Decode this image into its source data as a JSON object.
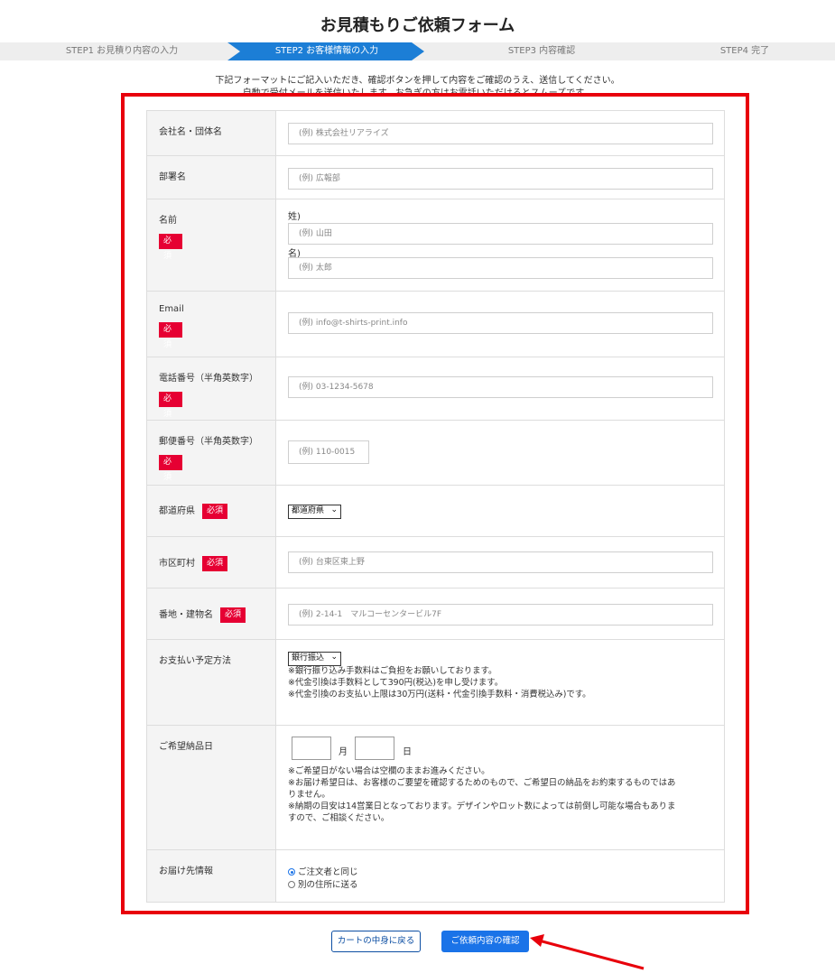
{
  "page": {
    "title": "お見積もりご依頼フォーム",
    "intro_line1": "下記フォーマットにご記入いただき、確認ボタンを押して内容をご確認のうえ、送信してください。",
    "intro_line2": "自動で受付メールを送信いたします。お急ぎの方はお電話いただけるとスムーズです。"
  },
  "steps": [
    {
      "label": "STEP1 お見積り内容の入力",
      "active": false
    },
    {
      "label": "STEP2 お客様情報の入力",
      "active": true
    },
    {
      "label": "STEP3 内容確認",
      "active": false
    },
    {
      "label": "STEP4 完了",
      "active": false
    }
  ],
  "required_label": "必須",
  "fields": {
    "company": {
      "label": "会社名・団体名",
      "placeholder": "(例) 株式会社リアライズ"
    },
    "department": {
      "label": "部署名",
      "placeholder": "(例) 広報部"
    },
    "name": {
      "label": "名前",
      "last_label": "姓)",
      "last_placeholder": "(例) 山田",
      "first_label": "名)",
      "first_placeholder": "(例) 太郎"
    },
    "email": {
      "label": "Email",
      "placeholder": "(例) info@t-shirts-print.info"
    },
    "phone": {
      "label": "電話番号（半角英数字）",
      "placeholder": "(例) 03-1234-5678"
    },
    "zip": {
      "label": "郵便番号（半角英数字）",
      "placeholder": "(例) 110-0015"
    },
    "prefecture": {
      "label": "都道府県",
      "selected": "都道府県"
    },
    "city": {
      "label": "市区町村",
      "placeholder": "(例) 台東区東上野"
    },
    "address": {
      "label": "番地・建物名",
      "placeholder": "(例) 2-14-1　マルコーセンタービル7F"
    },
    "payment": {
      "label": "お支払い予定方法",
      "selected": "銀行振込",
      "notes": [
        "※銀行振り込み手数料はご負担をお願いしております。",
        "※代金引換は手数料として390円(税込)を申し受けます。",
        "※代金引換のお支払い上限は30万円(送料・代金引換手数料・消費税込み)です。"
      ]
    },
    "delivery_date": {
      "label": "ご希望納品日",
      "month_unit": "月",
      "day_unit": "日",
      "notes": [
        "※ご希望日がない場合は空欄のままお進みください。",
        "※お届け希望日は、お客様のご要望を確認するためのもので、ご希望日の納品をお約束するものではあ",
        "りません。",
        "※納期の目安は14営業日となっております。デザインやロット数によっては前倒し可能な場合もありま",
        "すので、ご相談ください。"
      ]
    },
    "shipping": {
      "label": "お届け先情報",
      "options": [
        "ご注文者と同じ",
        "別の住所に送る"
      ],
      "selected_index": 0
    }
  },
  "buttons": {
    "back": "カートの中身に戻る",
    "confirm": "ご依頼内容の確認"
  },
  "colors": {
    "required_bg": "#e60033",
    "highlight_frame": "#e8000b",
    "step_active": "#1c7ed6",
    "primary_button": "#1a73e8"
  }
}
